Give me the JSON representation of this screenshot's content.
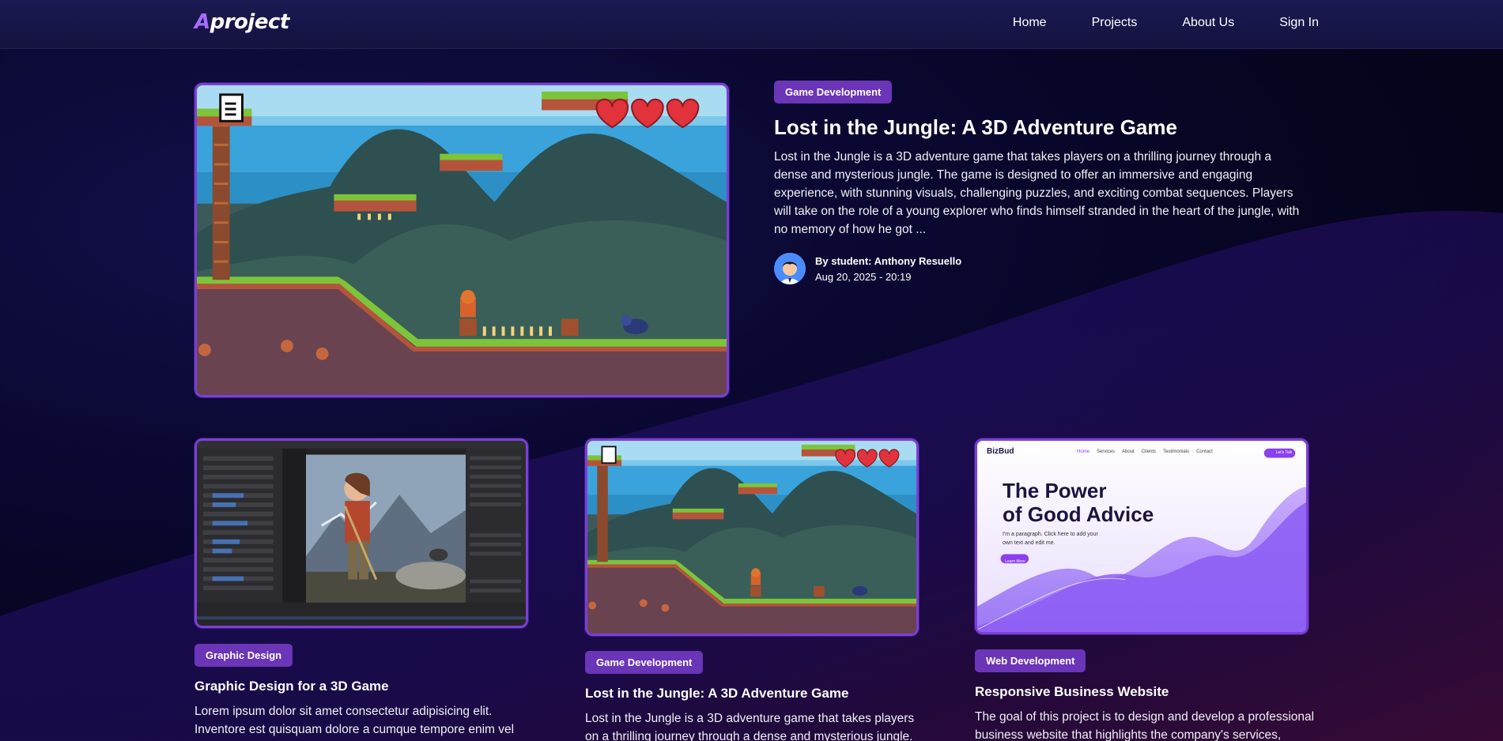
{
  "nav": {
    "logo_accent": "A",
    "logo_rest": "project",
    "links": [
      "Home",
      "Projects",
      "About Us",
      "Sign In"
    ]
  },
  "featured": {
    "category": "Game Development",
    "title": "Lost in the Jungle: A 3D Adventure Game",
    "description": "Lost in the Jungle is a 3D adventure game that takes players on a thrilling journey through a dense and mysterious jungle. The game is designed to offer an immersive and engaging experience, with stunning visuals, challenging puzzles, and exciting combat sequences. Players will take on the role of a young explorer who finds himself stranded in the heart of the jungle, with no memory of how he got ...",
    "author": "By student: Anthony Resuello",
    "date": "Aug 20, 2025 - 20:19"
  },
  "cards": [
    {
      "category": "Graphic Design",
      "title": "Graphic Design for a 3D Game",
      "description": "Lorem ipsum dolor sit amet consectetur adipisicing elit. Inventore est quisquam dolore a cumque tempore enim vel"
    },
    {
      "category": "Game Development",
      "title": "Lost in the Jungle: A 3D Adventure Game",
      "description": "Lost in the Jungle is a 3D adventure game that takes players on a thrilling journey through a dense and mysterious jungle."
    },
    {
      "category": "Web Development",
      "title": "Responsive Business Website",
      "description": "The goal of this project is to design and develop a professional business website that highlights the company's services,"
    }
  ],
  "mockup": {
    "brand": "BizBud",
    "nav": [
      "Home",
      "Services",
      "About",
      "Clients",
      "Testimonials",
      "Contact"
    ],
    "cta": "Let's Talk",
    "headline_1": "The Power",
    "headline_2": "of Good Advice",
    "paragraph_1": "I'm a paragraph. Click here to add your",
    "paragraph_2": "own text and edit me.",
    "button": "Learn More"
  },
  "colors": {
    "accent": "#a66bff",
    "badge": "#6b35b8",
    "border": "#7b3fd6",
    "nav_bg": "#1b1a52"
  }
}
